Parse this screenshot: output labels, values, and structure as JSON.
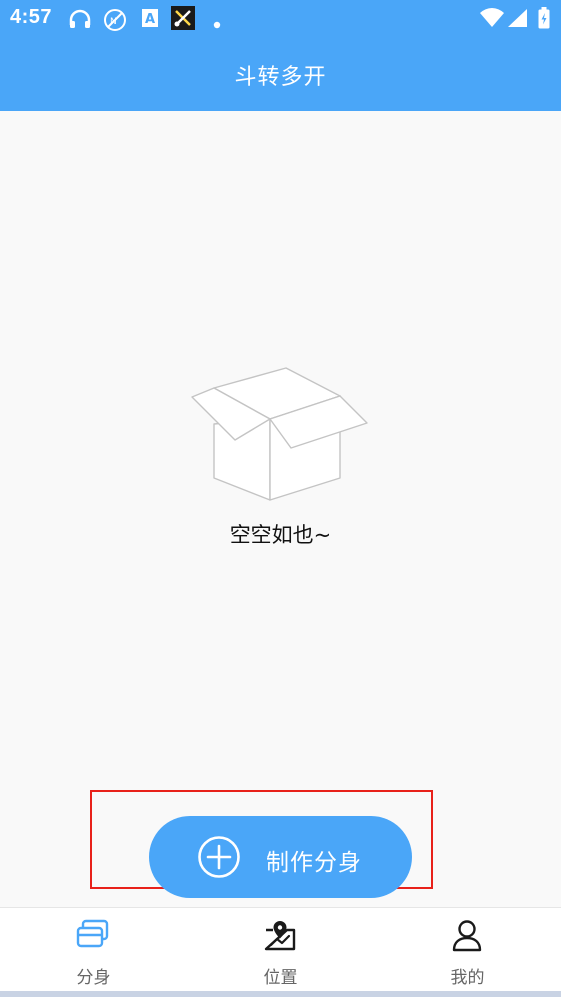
{
  "status_bar": {
    "time": "4:57",
    "icons": [
      "headset-icon",
      "no-data-icon",
      "font-a-icon",
      "tools-icon",
      "dot-icon",
      "wifi-icon",
      "signal-icon",
      "battery-icon"
    ]
  },
  "header": {
    "title": "斗转多开"
  },
  "empty_state": {
    "icon": "empty-box-icon",
    "text": "空空如也~"
  },
  "create_button": {
    "label": "制作分身",
    "icon": "plus-circle-icon"
  },
  "tabs": [
    {
      "label": "分身",
      "icon": "cards-icon",
      "active": true
    },
    {
      "label": "位置",
      "icon": "location-map-icon",
      "active": false
    },
    {
      "label": "我的",
      "icon": "person-icon",
      "active": false
    }
  ],
  "colors": {
    "accent": "#4aa6f8",
    "highlight_frame": "#e8211a",
    "background": "#f9f9f9"
  }
}
